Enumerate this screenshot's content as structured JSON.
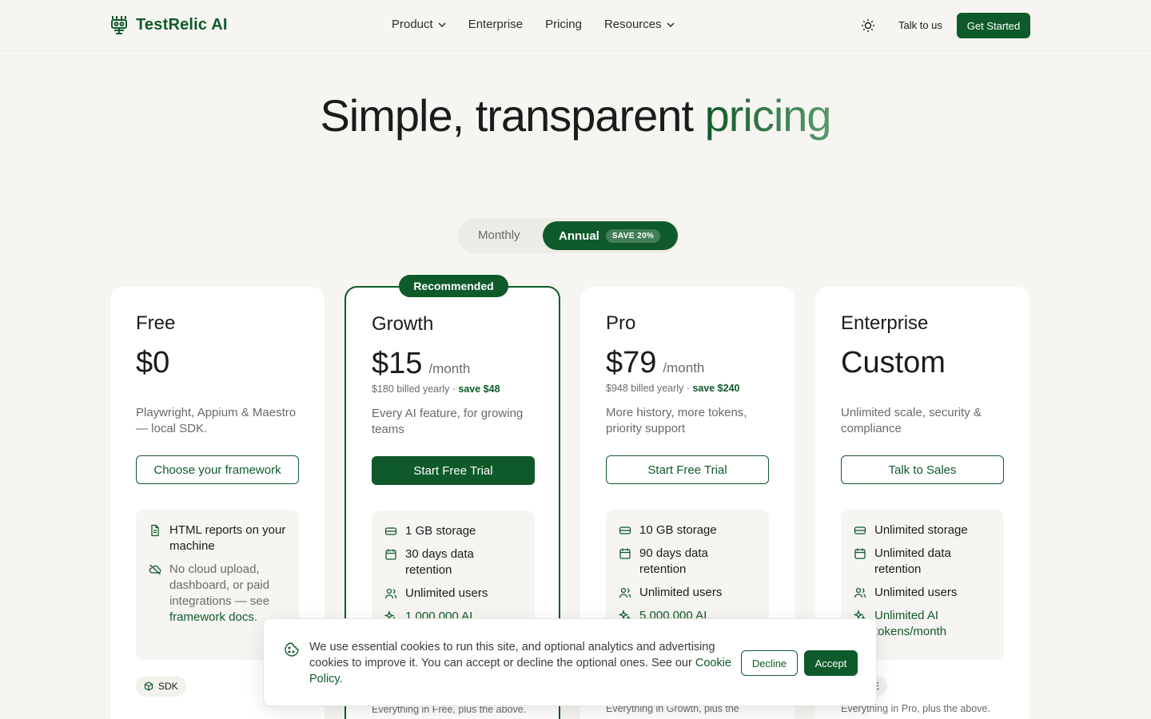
{
  "brand": {
    "name": "TestRelic AI",
    "color": "#0f5a2a"
  },
  "nav": {
    "items": [
      {
        "label": "Product",
        "has_dropdown": true
      },
      {
        "label": "Enterprise",
        "has_dropdown": false
      },
      {
        "label": "Pricing",
        "has_dropdown": false
      },
      {
        "label": "Resources",
        "has_dropdown": true
      }
    ],
    "talk_label": "Talk to us",
    "cta_label": "Get Started"
  },
  "hero": {
    "title_main": "Simple, transparent ",
    "title_accent": "pricing"
  },
  "billing_toggle": {
    "monthly": "Monthly",
    "annual": "Annual",
    "badge": "SAVE 20%",
    "selected": "Annual"
  },
  "plans": [
    {
      "name": "Free",
      "price": "$0",
      "unit": "",
      "billed": "",
      "save": "",
      "description": "Playwright, Appium & Maestro — local SDK.",
      "cta": "Choose your framework",
      "features": [
        {
          "icon": "file-icon",
          "text": "HTML reports on your machine"
        },
        {
          "icon": "cloud-off-icon",
          "text": "No cloud upload, dashboard, or paid integrations — see ",
          "link": "framework docs",
          "after": "."
        }
      ],
      "tag": "SDK",
      "footnote": ""
    },
    {
      "name": "Growth",
      "price": "$15",
      "unit": "/month",
      "billed": "$180 billed yearly · ",
      "save": "save $48",
      "recommended": "Recommended",
      "description": "Every AI feature, for growing teams",
      "cta": "Start Free Trial",
      "features": [
        {
          "icon": "storage-icon",
          "text": "1 GB storage"
        },
        {
          "icon": "calendar-icon",
          "text": "30 days data retention"
        },
        {
          "icon": "users-icon",
          "text": "Unlimited users"
        },
        {
          "icon": "sparkles-icon",
          "text": "1,000,000 AI"
        }
      ],
      "footnote": "Everything in Free, plus the above."
    },
    {
      "name": "Pro",
      "price": "$79",
      "unit": "/month",
      "billed": "$948 billed yearly · ",
      "save": "save $240",
      "description": "More history, more tokens, priority support",
      "cta": "Start Free Trial",
      "features": [
        {
          "icon": "storage-icon",
          "text": "10 GB storage"
        },
        {
          "icon": "calendar-icon",
          "text": "90 days data retention"
        },
        {
          "icon": "users-icon",
          "text": "Unlimited users"
        },
        {
          "icon": "sparkles-icon",
          "text": "5,000,000 AI"
        }
      ],
      "footnote": "Everything in Growth, plus the"
    },
    {
      "name": "Enterprise",
      "price": "Custom",
      "unit": "",
      "billed": "",
      "save": "",
      "description": "Unlimited scale, security & compliance",
      "cta": "Talk to Sales",
      "features": [
        {
          "icon": "storage-icon",
          "text": "Unlimited storage"
        },
        {
          "icon": "calendar-icon",
          "text": "Unlimited data retention"
        },
        {
          "icon": "users-icon",
          "text": "Unlimited users"
        },
        {
          "icon": "sparkles-icon",
          "text": "Unlimited AI tokens/month"
        }
      ],
      "tag": "IDE",
      "footnote": "Everything in Pro, plus the above."
    }
  ],
  "cookie": {
    "text": "We use essential cookies to run this site, and optional analytics and advertising cookies to improve it. You can accept or decline the optional ones. See our ",
    "link": "Cookie Policy",
    "after": ".",
    "decline": "Decline",
    "accept": "Accept"
  }
}
